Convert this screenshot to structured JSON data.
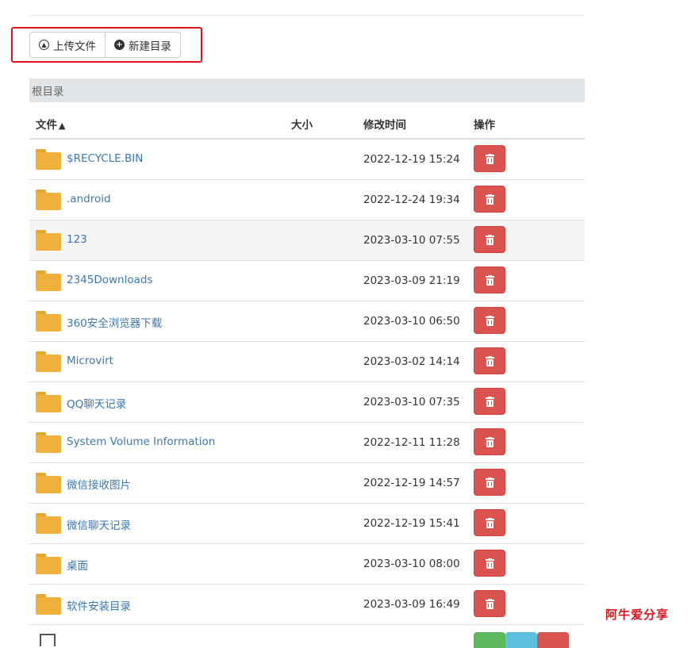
{
  "toolbar": {
    "upload_label": "上传文件",
    "upload_icon": "upload-circle-icon",
    "new_dir_label": "新建目录",
    "new_dir_icon": "plus-circle-icon"
  },
  "breadcrumb": {
    "root_label": "根目录"
  },
  "table": {
    "headers": {
      "name": "文件",
      "size": "大小",
      "modified": "修改时间",
      "actions": "操作"
    },
    "sort": {
      "column": "name",
      "direction": "ascending",
      "icon": "caret-up-icon"
    },
    "rows": [
      {
        "name": "$RECYCLE.BIN",
        "size": "",
        "modified": "2022-12-19 15:24",
        "type": "folder"
      },
      {
        "name": ".android",
        "size": "",
        "modified": "2022-12-24 19:34",
        "type": "folder"
      },
      {
        "name": "123",
        "size": "",
        "modified": "2023-03-10 07:55",
        "type": "folder"
      },
      {
        "name": "2345Downloads",
        "size": "",
        "modified": "2023-03-09 21:19",
        "type": "folder"
      },
      {
        "name": "360安全浏览器下载",
        "size": "",
        "modified": "2023-03-10 06:50",
        "type": "folder"
      },
      {
        "name": "Microvirt",
        "size": "",
        "modified": "2023-03-02 14:14",
        "type": "folder"
      },
      {
        "name": "QQ聊天记录",
        "size": "",
        "modified": "2023-03-10 07:35",
        "type": "folder"
      },
      {
        "name": "System Volume Information",
        "size": "",
        "modified": "2022-12-11 11:28",
        "type": "folder"
      },
      {
        "name": "微信接收图片",
        "size": "",
        "modified": "2022-12-19 14:57",
        "type": "folder"
      },
      {
        "name": "微信聊天记录",
        "size": "",
        "modified": "2022-12-19 15:41",
        "type": "folder"
      },
      {
        "name": "桌面",
        "size": "",
        "modified": "2023-03-10 08:00",
        "type": "folder"
      },
      {
        "name": "软件安装目录",
        "size": "",
        "modified": "2023-03-09 16:49",
        "type": "folder"
      }
    ]
  },
  "colors": {
    "highlight": "#e0121b",
    "link": "#3c78b0",
    "folder": "#f0b13a",
    "danger": "#d9534f",
    "success": "#5cb85c",
    "info": "#5bc0de",
    "breadcrumb_bg": "#e2e5e8"
  },
  "watermark": "阿牛爱分享"
}
